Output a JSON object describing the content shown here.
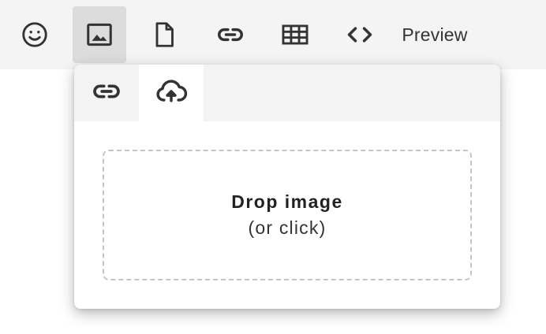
{
  "toolbar": {
    "buttons": [
      {
        "name": "emoji",
        "icon": "emoji-icon",
        "active": false
      },
      {
        "name": "image",
        "icon": "image-icon",
        "active": true
      },
      {
        "name": "file",
        "icon": "file-icon",
        "active": false
      },
      {
        "name": "link",
        "icon": "link-icon",
        "active": false
      },
      {
        "name": "table",
        "icon": "table-icon",
        "active": false
      },
      {
        "name": "code",
        "icon": "code-icon",
        "active": false
      }
    ],
    "preview_label": "Preview"
  },
  "image_popover": {
    "tabs": [
      {
        "name": "link",
        "icon": "link-icon",
        "active": false
      },
      {
        "name": "upload",
        "icon": "cloud-upload-icon",
        "active": true
      }
    ],
    "dropzone": {
      "title": "Drop image",
      "subtitle": "(or click)"
    }
  },
  "colors": {
    "toolbar_bg": "#f4f4f4",
    "active_button_bg": "#dcdcdc",
    "icon": "#333333",
    "dropzone_border": "#c4c4c4"
  }
}
